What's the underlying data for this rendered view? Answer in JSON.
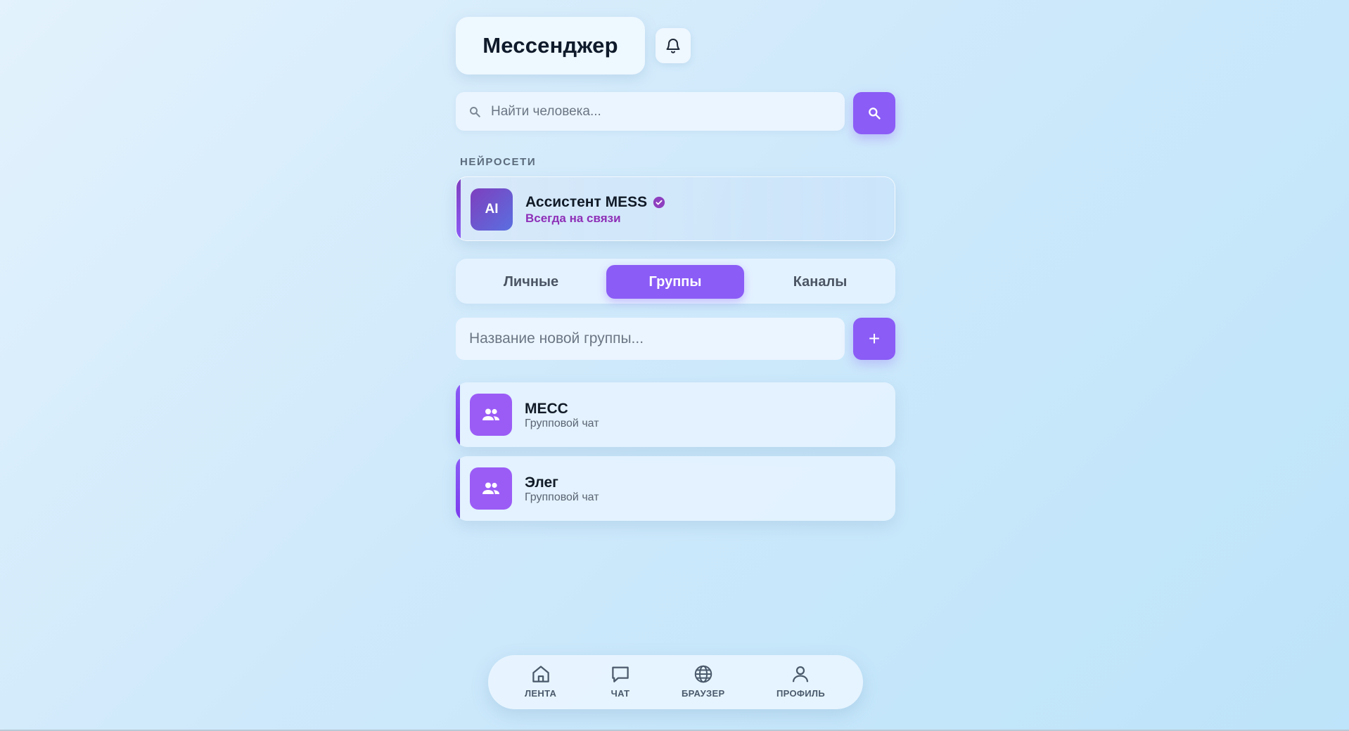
{
  "header": {
    "title": "Мессенджер",
    "bell_icon": "bell-icon"
  },
  "search": {
    "placeholder": "Найти человека...",
    "icon": "search-icon",
    "button_icon": "search-icon"
  },
  "section_ai": {
    "label": "НЕЙРОСЕТИ"
  },
  "ai_assistant": {
    "avatar_text": "AI",
    "name": "Ассистент MESS",
    "verified_icon": "verified-check-icon",
    "status": "Всегда на связи"
  },
  "tabs": [
    {
      "label": "Личные",
      "active": false
    },
    {
      "label": "Группы",
      "active": true
    },
    {
      "label": "Каналы",
      "active": false
    }
  ],
  "new_group": {
    "placeholder": "Название новой группы...",
    "add_label": "+"
  },
  "groups": [
    {
      "name": "MECC",
      "subtitle": "Групповой чат",
      "icon": "group-users-icon"
    },
    {
      "name": "Элег",
      "subtitle": "Групповой чат",
      "icon": "group-users-icon"
    }
  ],
  "bottom_nav": [
    {
      "label": "ЛЕНТА",
      "icon": "home-icon"
    },
    {
      "label": "ЧАТ",
      "icon": "chat-icon"
    },
    {
      "label": "БРАУЗЕР",
      "icon": "globe-icon"
    },
    {
      "label": "ПРОФИЛЬ",
      "icon": "user-icon"
    }
  ],
  "colors": {
    "accent": "#8b5cf6",
    "ai_status": "#8e2fb7",
    "background": "#cfe9fb"
  }
}
